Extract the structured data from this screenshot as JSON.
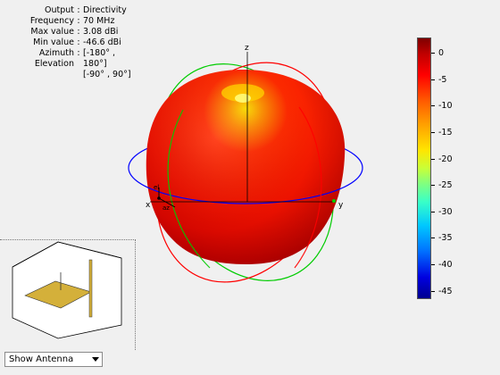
{
  "info": {
    "rows": [
      {
        "label": "Output",
        "value": "Directivity"
      },
      {
        "label": "Frequency",
        "value": "70 MHz"
      },
      {
        "label": "Max value",
        "value": "3.08 dBi"
      },
      {
        "label": "Min value",
        "value": "-46.6 dBi"
      },
      {
        "label": "Azimuth",
        "value": "[-180° ,"
      },
      {
        "label": "Elevation",
        "value": "180°]"
      },
      {
        "label": "",
        "value": "[-90° , 90°]"
      }
    ]
  },
  "axes": {
    "x": "x",
    "y": "y",
    "z": "z",
    "az": "az",
    "el": "el"
  },
  "colorbar": {
    "ticks": [
      "0",
      "-5",
      "-10",
      "-15",
      "-20",
      "-25",
      "-30",
      "-35",
      "-40",
      "-45"
    ],
    "max": 3.08,
    "min": -46.6
  },
  "antenna_control": {
    "selected": "Show Antenna"
  },
  "colors": {
    "pattern": "#ee1a00",
    "azimuth_circle": "#0000ff",
    "elevation_circle_red": "#ff0000",
    "elevation_circle_green": "#00cc00",
    "antenna_ground": "#d4b03a"
  }
}
